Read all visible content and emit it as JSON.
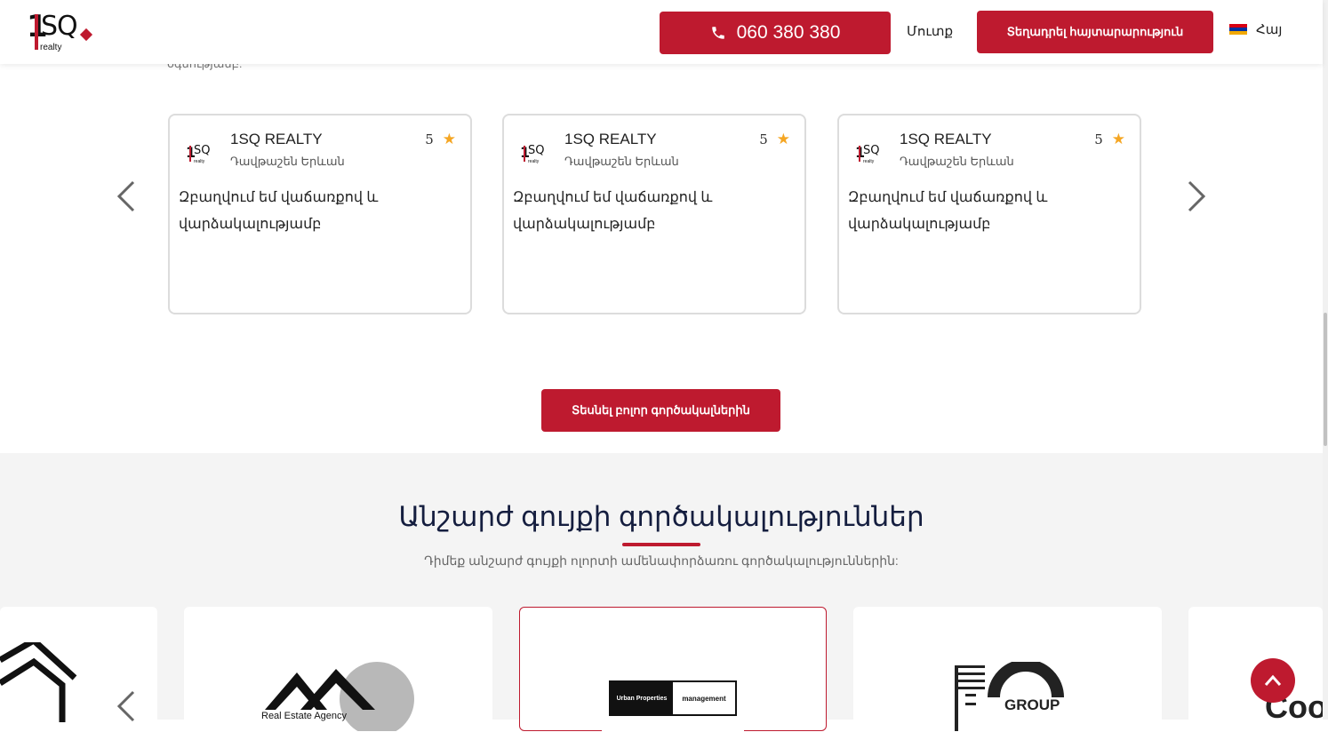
{
  "header": {
    "logo_number": "1",
    "logo_letters": "SQ",
    "logo_sub": "realty",
    "phone": "060 380 380",
    "login": "Մուտք",
    "post_ad": "Տեղադրել հայտարարություն",
    "language": "Հայ"
  },
  "previous_text": "օգնությամբ:",
  "reviews": [
    {
      "agency": "1SQ REALTY",
      "district": "Դավթաշեն Երևան",
      "rating": "5",
      "text": "Զբաղվում եմ վաճառքով և վարձակալությամբ"
    },
    {
      "agency": "1SQ REALTY",
      "district": "Դավթաշեն Երևան",
      "rating": "5",
      "text": "Զբաղվում եմ վաճառքով և վարձակալությամբ"
    },
    {
      "agency": "1SQ REALTY",
      "district": "Դավթաշեն Երևան",
      "rating": "5",
      "text": "Զբաղվում եմ վաճառքով և վարձակալությամբ"
    }
  ],
  "all_agents_button": "Տեսնել բոլոր գործակալներին",
  "agencies": {
    "title": "Անշարժ գույքի գործակալություններ",
    "subtitle": "Դիմեք անշարժ գույքի ոլորտի ամենափորձառու գործակալություններին:",
    "logos": [
      {
        "name": "house-logo",
        "text": ""
      },
      {
        "name": "real-estate-agency-logo",
        "text": "Real Estate Agency"
      },
      {
        "name": "urban-properties-logo",
        "text": "Urban Properties",
        "text2": "management"
      },
      {
        "name": "group-logo",
        "text": "GROUP"
      },
      {
        "name": "partial-logo",
        "text": "Coo"
      }
    ]
  },
  "colors": {
    "accent": "#be1a2f",
    "star": "#f5a623",
    "title": "#151e3f"
  },
  "icons": [
    "phone-icon",
    "armenian-flag-icon",
    "chevron-left-icon",
    "chevron-right-icon",
    "star-icon",
    "arrow-up-icon"
  ]
}
